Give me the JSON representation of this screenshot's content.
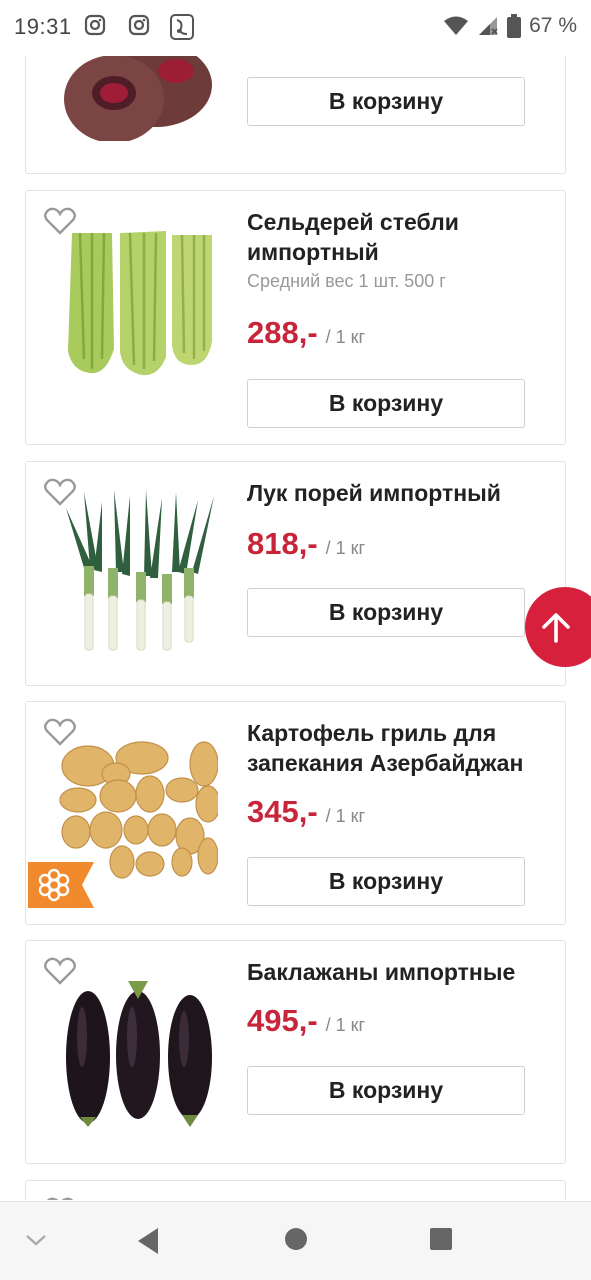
{
  "status_bar": {
    "time": "19:31",
    "battery": "67 %",
    "icons": [
      "instagram-icon",
      "instagram-icon",
      "app-icon",
      "wifi-icon",
      "signal-icon",
      "battery-icon"
    ]
  },
  "add_to_cart_label": "В корзину",
  "products": [
    {
      "title": "",
      "image": "beet",
      "price": "",
      "unit": "",
      "button": "В корзину"
    },
    {
      "title": "Сельдерей стебли импортный",
      "weight": "Средний вес 1 шт. 500 г",
      "price": "288,-",
      "unit": "/ 1 кг",
      "button": "В корзину",
      "image": "celery"
    },
    {
      "title": "Лук порей импортный",
      "price": "818,-",
      "unit": "/ 1 кг",
      "button": "В корзину",
      "image": "leek"
    },
    {
      "title": "Картофель гриль для запекания Азербайджан",
      "price": "345,-",
      "unit": "/ 1 кг",
      "button": "В корзину",
      "image": "potato",
      "badge": "flower-badge-icon"
    },
    {
      "title": "Баклажаны импортные",
      "price": "495,-",
      "unit": "/ 1 кг",
      "button": "В корзину",
      "image": "eggplant"
    }
  ],
  "colors": {
    "price": "#c8253a",
    "scroll_top": "#d6203c",
    "badge": "#f08a2c"
  }
}
